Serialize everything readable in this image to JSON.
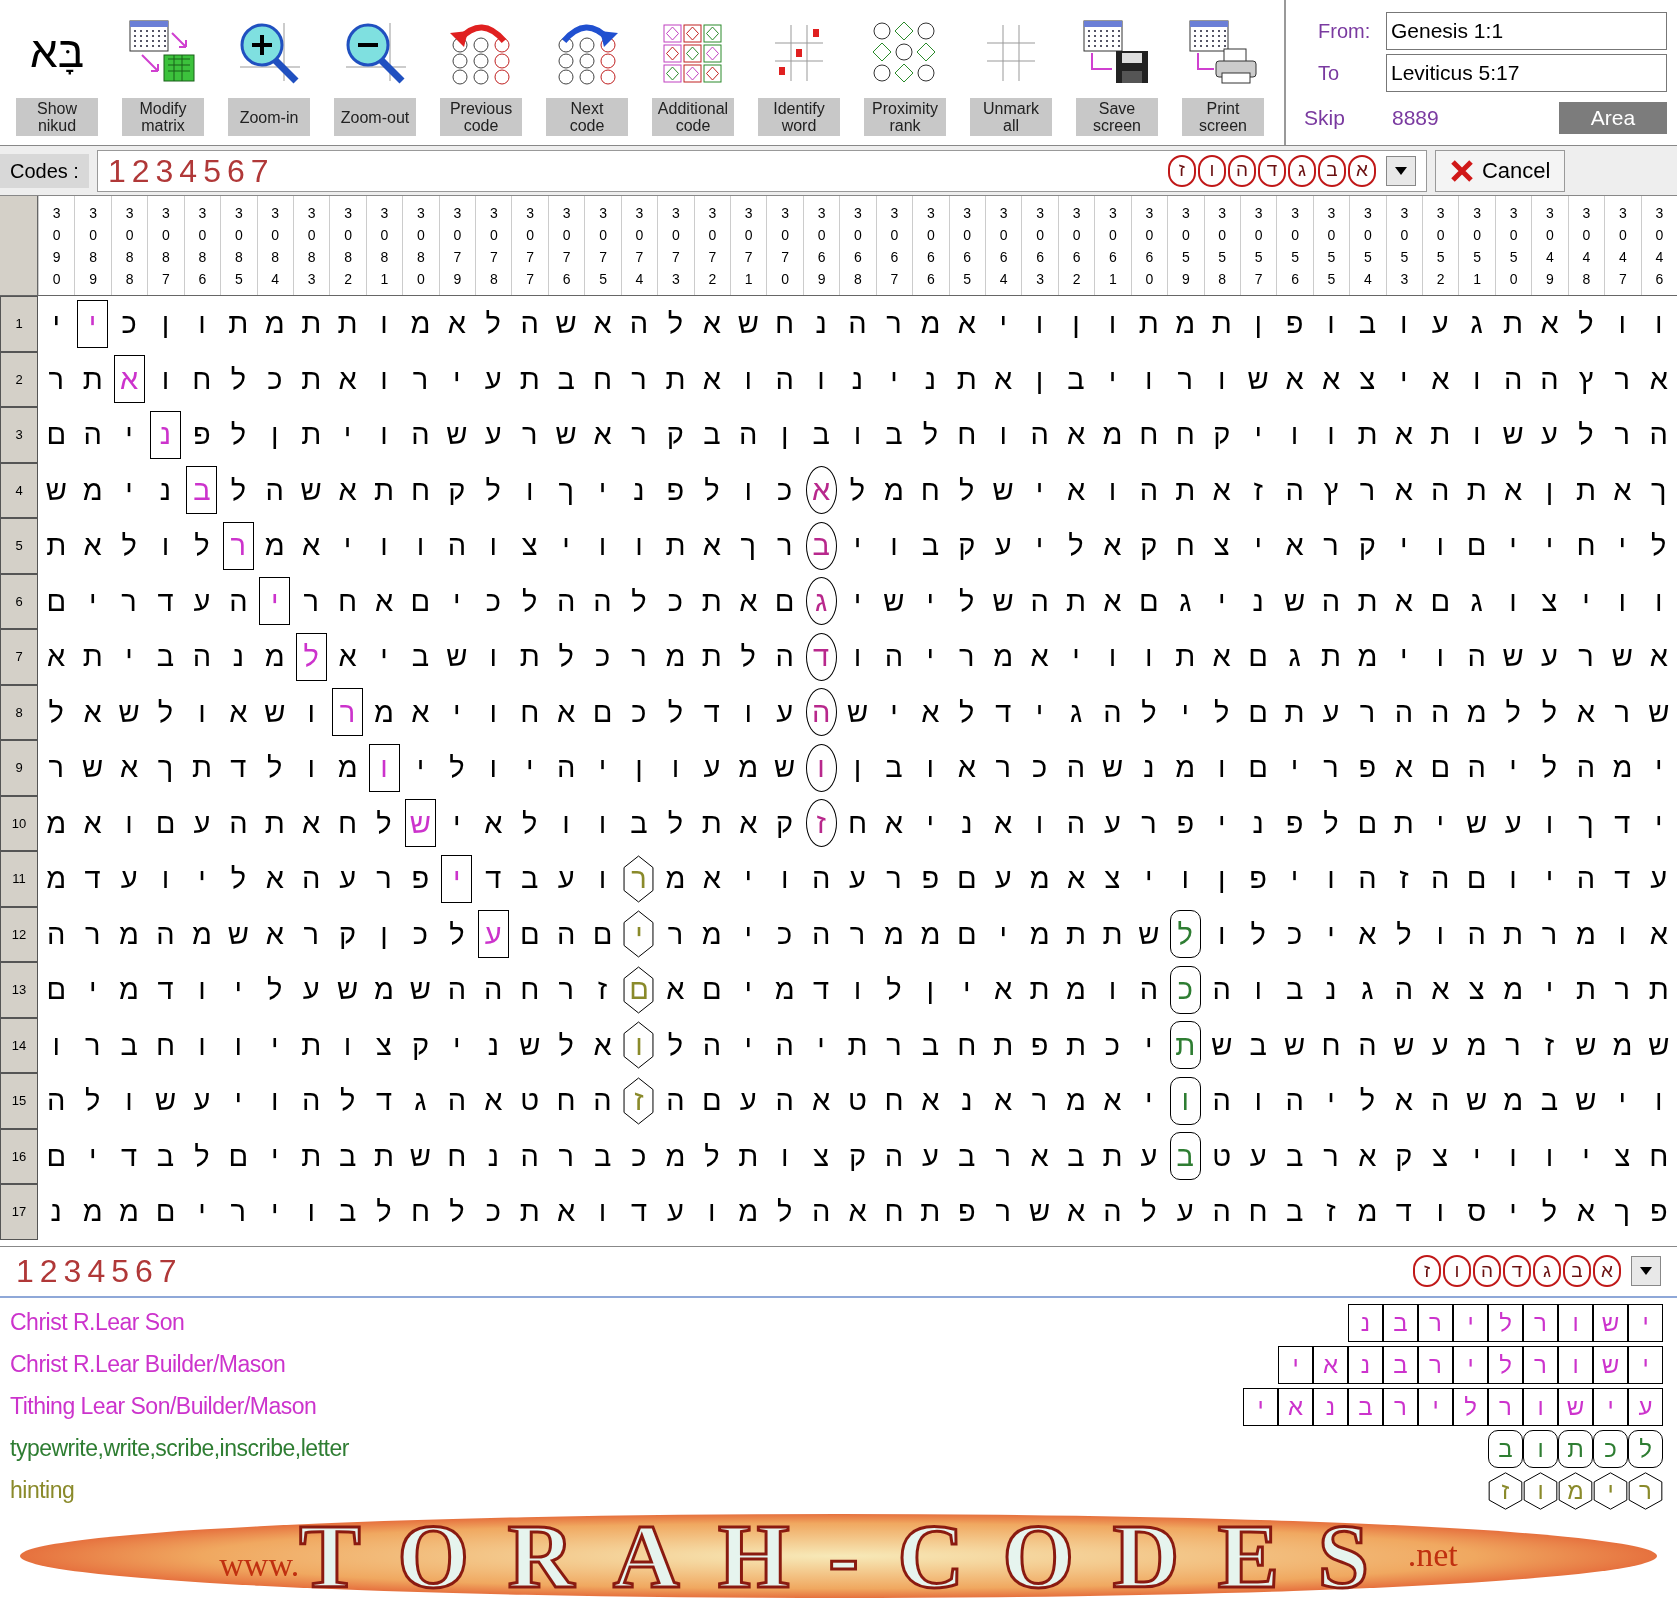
{
  "toolbar": {
    "buttons": [
      {
        "glyph": "בָּא",
        "lines": [
          "Show",
          "nikud"
        ]
      },
      {
        "lines": [
          "Modify",
          "matrix"
        ]
      },
      {
        "lines": [
          "Zoom-in"
        ]
      },
      {
        "lines": [
          "Zoom-out"
        ]
      },
      {
        "lines": [
          "Previous",
          "code"
        ]
      },
      {
        "lines": [
          "Next",
          "code"
        ]
      },
      {
        "lines": [
          "Additional",
          "code"
        ]
      },
      {
        "lines": [
          "Identify",
          "word"
        ]
      },
      {
        "lines": [
          "Proximity",
          "rank"
        ]
      },
      {
        "lines": [
          "Unmark",
          "all"
        ]
      },
      {
        "lines": [
          "Save",
          "screen"
        ]
      },
      {
        "lines": [
          "Print",
          "screen"
        ]
      }
    ],
    "from_label": "From:",
    "from": "Genesis 1:1",
    "to_label": "To",
    "to": "Leviticus 5:17",
    "skip_label": "Skip",
    "skip": "8889",
    "area_button": "Area"
  },
  "codes_bar": {
    "label": "Codes :",
    "value": "1234567",
    "letters": "א ב ג ד ה ו ז",
    "cancel": "Cancel"
  },
  "columns": [
    "3090",
    "3089",
    "3088",
    "3087",
    "3086",
    "3085",
    "3084",
    "3083",
    "3082",
    "3081",
    "3080",
    "3079",
    "3078",
    "3077",
    "3076",
    "3075",
    "3074",
    "3073",
    "3072",
    "3071",
    "3070",
    "3069",
    "3068",
    "3067",
    "3066",
    "3065",
    "3064",
    "3063",
    "3062",
    "3061",
    "3060",
    "3059",
    "3058",
    "3057",
    "3056",
    "3055",
    "3054",
    "3053",
    "3052",
    "3051",
    "3050",
    "3049",
    "3048",
    "3047",
    "3046"
  ],
  "rows": [
    {
      "number": "1",
      "segments": [
        {
          "kind": "plain",
          "text": "ו ו ל א ת ג ע ו ב ו פ ן ת מ ת ו ן ו י א מ ר ה נ ח ש א ל ה א ש ה ל א מ ו ת ת מ ת ו ן כ"
        },
        {
          "kind": "boxed",
          "text": "י",
          "color": "#cc33cc"
        },
        {
          "kind": "plain",
          "text": "י"
        }
      ]
    },
    {
      "number": "2",
      "segments": [
        {
          "kind": "plain",
          "text": "א ר ץ ה ה ו א י צ א א ש ו ר ו י ב ן א ת נ י נ ו ה ו א ת ר ח ב ת ע י ר ו א ת כ ל ח ו"
        },
        {
          "kind": "boxed",
          "text": "א",
          "color": "#cc33cc"
        },
        {
          "kind": "plain",
          "text": "ת ר"
        }
      ]
    },
    {
      "number": "3",
      "segments": [
        {
          "kind": "plain",
          "text": "ה ר ל ע ש ו ת א ת ו ו י ק ח ח מ א ה ו ח ל ב ו ב ן ה ב ק ר א ש ר ע ש ה ו י ת ן ל פ"
        },
        {
          "kind": "boxed",
          "text": "נ",
          "color": "#cc33cc"
        },
        {
          "kind": "plain",
          "text": "י ה ם"
        }
      ]
    },
    {
      "number": "4",
      "segments": [
        {
          "kind": "plain",
          "text": "ך א ת ן א ת ה א ר ץ ה ז א ת ה ו א י ש ל ח מ ל"
        },
        {
          "kind": "oval",
          "text": "א",
          "color": "#b8288c"
        },
        {
          "kind": "plain",
          "text": "כ ו ל פ נ י ך ו ל ק ח ת א ש ה ל"
        },
        {
          "kind": "boxed",
          "text": "ב",
          "color": "#cc33cc"
        },
        {
          "kind": "plain",
          "text": "נ י מ ש"
        }
      ]
    },
    {
      "number": "5",
      "segments": [
        {
          "kind": "plain",
          "text": "ל י ח י י ם ו י ק ר א י צ ח ק א ל י ע ק ב ו י"
        },
        {
          "kind": "oval",
          "text": "ב",
          "color": "#b8288c"
        },
        {
          "kind": "plain",
          "text": "ר ך א ת ו ו י צ ו ה ו ו י א מ"
        },
        {
          "kind": "boxed",
          "text": "ר",
          "color": "#cc33cc"
        },
        {
          "kind": "plain",
          "text": "ל ו ל א ת"
        }
      ]
    },
    {
      "number": "6",
      "segments": [
        {
          "kind": "plain",
          "text": "ו ו י צ ו ג ם א ת ה ש נ י ג ם א ת ה ש ל י ש י"
        },
        {
          "kind": "oval",
          "text": "ג",
          "color": "#b8288c"
        },
        {
          "kind": "plain",
          "text": "ם א ת כ ל ה ה ל כ י ם א ח ר"
        },
        {
          "kind": "boxed",
          "text": "י",
          "color": "#cc33cc"
        },
        {
          "kind": "plain",
          "text": "ה ע ד ר י ם"
        }
      ]
    },
    {
      "number": "7",
      "segments": [
        {
          "kind": "plain",
          "text": "א ש ר ע ש ה ו י מ ת ג ם א ת ו ו י א מ ר י ה ו"
        },
        {
          "kind": "oval",
          "text": "ד",
          "color": "#b8288c"
        },
        {
          "kind": "plain",
          "text": "ה ל ת מ ר כ ל ת ו ש ב י א"
        },
        {
          "kind": "boxed",
          "text": "ל",
          "color": "#cc33cc"
        },
        {
          "kind": "plain",
          "text": "מ נ ה ב י ת א"
        }
      ]
    },
    {
      "number": "8",
      "segments": [
        {
          "kind": "plain",
          "text": "ש ר א ל ל מ ה ה ר ע ת ם ל י ל ה ג י ד ל א י ש"
        },
        {
          "kind": "oval",
          "text": "ה",
          "color": "#b8288c"
        },
        {
          "kind": "plain",
          "text": "ע ו ד ל כ ם א ח ו י א מ"
        },
        {
          "kind": "boxed",
          "text": "ר",
          "color": "#cc33cc"
        },
        {
          "kind": "plain",
          "text": "ו ש א ו ל ש א ל"
        }
      ]
    },
    {
      "number": "9",
      "segments": [
        {
          "kind": "plain",
          "text": "י מ ה ל י ה ם א פ ר י ם ו מ נ ש ה כ ר א ו ב ן"
        },
        {
          "kind": "oval",
          "text": "ו",
          "color": "#b8288c"
        },
        {
          "kind": "plain",
          "text": "ש מ ע ו ן י ה י ו ל י"
        },
        {
          "kind": "boxed",
          "text": "ו",
          "color": "#cc33cc"
        },
        {
          "kind": "plain",
          "text": "מ ו ל ד ת ך א ש ר"
        }
      ]
    },
    {
      "number": "10",
      "segments": [
        {
          "kind": "plain",
          "text": "י ד ך ו ע ש י ת ם ל פ נ י פ ר ע ה ו א נ י א ח"
        },
        {
          "kind": "oval",
          "text": "ז",
          "color": "#b8288c"
        },
        {
          "kind": "plain",
          "text": "ק א ת ל ב ו ו ל א י"
        },
        {
          "kind": "boxed",
          "text": "ש",
          "color": "#cc33cc"
        },
        {
          "kind": "plain",
          "text": "ל ח א ת ה ע ם ו א מ"
        }
      ]
    },
    {
      "number": "11",
      "segments": [
        {
          "kind": "plain",
          "text": "ע ד ה י ו ם ה ז ה ו י פ ן ו י צ א מ ע ם פ ר ע ה ו י א מ"
        },
        {
          "kind": "hexagon",
          "text": "ר",
          "color": "#8a8a2a"
        },
        {
          "kind": "plain",
          "text": "ו ע ב ד"
        },
        {
          "kind": "boxed",
          "text": "י",
          "color": "#cc33cc"
        },
        {
          "kind": "plain",
          "text": "פ ר ע ה א ל י ו ע ד מ"
        }
      ]
    },
    {
      "number": "12",
      "segments": [
        {
          "kind": "plain",
          "text": "א ו מ ר ת ה ו ל א י כ ל ו"
        },
        {
          "kind": "rounded",
          "text": "ל",
          "color": "#2e7d32"
        },
        {
          "kind": "plain",
          "text": "ש ת ת מ י ם מ מ ר ה כ י מ ר"
        },
        {
          "kind": "hexagon",
          "text": "י",
          "color": "#8a8a2a"
        },
        {
          "kind": "plain",
          "text": "ם ה ם"
        },
        {
          "kind": "boxed",
          "text": "ע",
          "color": "#cc33cc"
        },
        {
          "kind": "plain",
          "text": "ל כ ן ק ר א ש מ ה מ ר ה"
        }
      ]
    },
    {
      "number": "13",
      "segments": [
        {
          "kind": "plain",
          "text": "ת ר ת י מ צ א ה ג נ ב ו ה"
        },
        {
          "kind": "rounded",
          "text": "כ",
          "color": "#2e7d32"
        },
        {
          "kind": "plain",
          "text": "ה ו מ ת א י ן ל ו ד מ י ם א"
        },
        {
          "kind": "hexagon",
          "text": "ם",
          "color": "#8a8a2a"
        },
        {
          "kind": "plain",
          "text": "ז ר ח ה ה ש מ ש ע ל י ו ד מ י ם"
        }
      ]
    },
    {
      "number": "14",
      "segments": [
        {
          "kind": "plain",
          "text": "ש מ ש ז ר מ ע ש ה ח ש ב ש"
        },
        {
          "kind": "rounded",
          "text": "ת",
          "color": "#2e7d32"
        },
        {
          "kind": "plain",
          "text": "י כ ת פ ת ח ב ר ת י ה י ה ל"
        },
        {
          "kind": "hexagon",
          "text": "ו",
          "color": "#8a8a2a"
        },
        {
          "kind": "plain",
          "text": "א ל ש נ י ק צ ו ת י ו ו ח ב ר ו"
        }
      ]
    },
    {
      "number": "15",
      "segments": [
        {
          "kind": "plain",
          "text": "ו י ש ב מ ש ה א ל י ה ו ה"
        },
        {
          "kind": "rounded",
          "text": "ו",
          "color": "#2e7d32"
        },
        {
          "kind": "plain",
          "text": "י א מ ר א נ א ח ט א ה ע ם ה"
        },
        {
          "kind": "hexagon",
          "text": "ז",
          "color": "#8a8a2a"
        },
        {
          "kind": "plain",
          "text": "ה ח ט א ה ג ד ל ה ו י ע ש ו ל ה"
        }
      ]
    },
    {
      "number": "16",
      "segments": [
        {
          "kind": "plain",
          "text": "ח צ י ו ו י צ ק א ר ב ע ט"
        },
        {
          "kind": "rounded",
          "text": "ב",
          "color": "#2e7d32"
        },
        {
          "kind": "plain",
          "text": "ע ת ב א ר ב ע ה ק צ ו ת ל מ כ ב ר ה נ ח ש ת ב ת י ם ל ב ד י ם"
        }
      ]
    },
    {
      "number": "17",
      "segments": [
        {
          "kind": "plain",
          "text": "פ ך א ל י ס ו ד מ ז ב ח ה ע ל ה א ש ר פ ת ח א ה ל מ ו ע ד ו א ת כ ל ח ל ב ו י ר י ם מ מ נ"
        }
      ]
    }
  ],
  "results_bar": {
    "value": "1234567",
    "letters": "א ב ג ד ה ו ז"
  },
  "legend": [
    {
      "text": "Christ R.Lear Son",
      "letters": "י ש ו ר ל י ר ב נ",
      "kind": "boxed",
      "color": "#cc33cc"
    },
    {
      "text": "Christ R.Lear Builder/Mason",
      "letters": "י ש ו ר ל י ר ב נ א י",
      "kind": "boxed",
      "color": "#cc33cc"
    },
    {
      "text": "Tithing Lear Son/Builder/Mason",
      "letters": "ע י ש ו ר ל י ר ב נ א י",
      "kind": "boxed",
      "color": "#cc33cc"
    },
    {
      "text": "typewrite,write,scribe,inscribe,letter",
      "letters": "ל כ ת ו ב",
      "kind": "rounded",
      "color": "#2e7d32"
    },
    {
      "text": "hinting",
      "letters": "ר י מ ו ז",
      "kind": "hexagon",
      "color": "#8a8a2a"
    }
  ],
  "banner": {
    "prefix": "www.",
    "name": "TORAH-CODES",
    "suffix": ".net"
  }
}
